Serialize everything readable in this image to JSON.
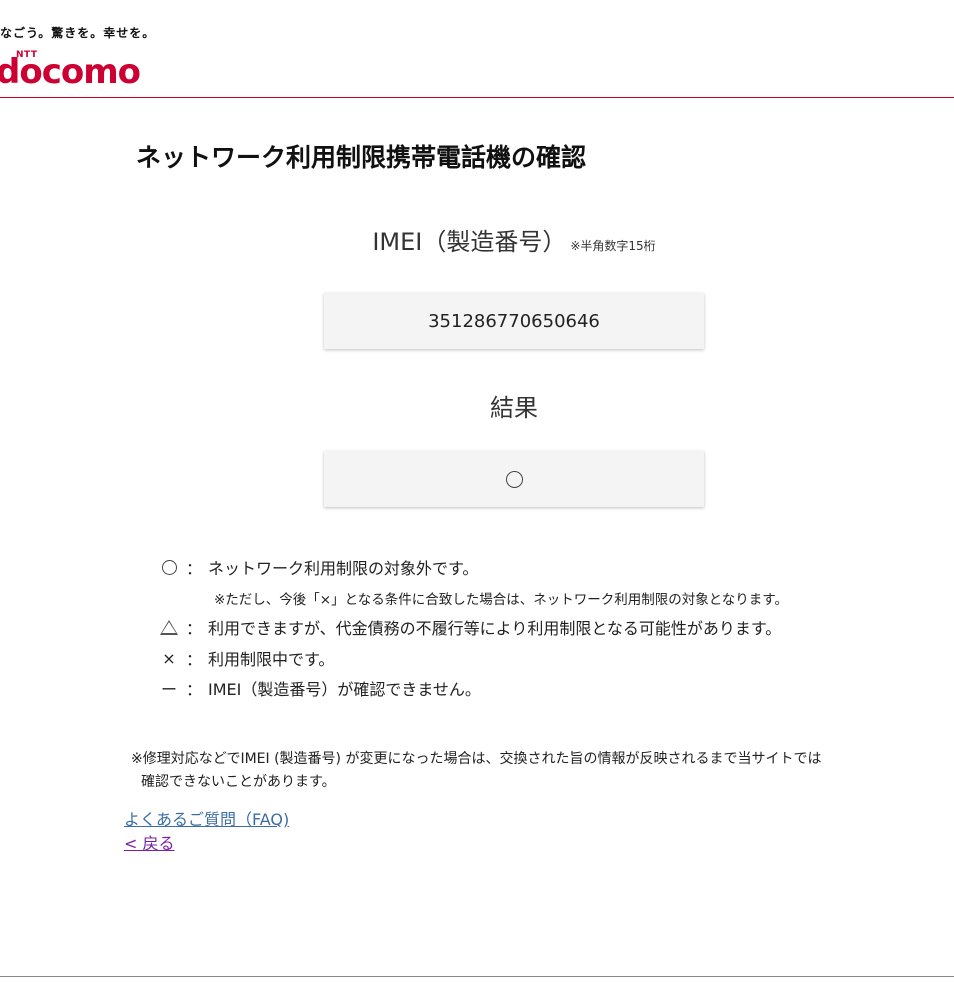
{
  "header": {
    "tagline": "なごう。驚きを。幸せを。",
    "logo_ntt": "NTT",
    "logo_text": "docomo"
  },
  "page_title": "ネットワーク利用制限携帯電話機の確認",
  "imei": {
    "label": "IMEI（製造番号）",
    "note": "※半角数字15桁",
    "value": "351286770650646"
  },
  "result": {
    "label": "結果",
    "value_icon": "circle-icon"
  },
  "legend": [
    {
      "symbol_icon": "circle-icon",
      "colon": "：",
      "text": "ネットワーク利用制限の対象外です。"
    },
    {
      "symbol_icon": "triangle-icon",
      "colon": "：",
      "text": "利用できますが、代金債務の不履行等により利用制限となる可能性があります。"
    },
    {
      "symbol": "×",
      "colon": "：",
      "text": "利用制限中です。"
    },
    {
      "symbol": "ー",
      "colon": "：",
      "text": "IMEI（製造番号）が確認できません。"
    }
  ],
  "legend_sub": "※ただし、今後「×」となる条件に合致した場合は、ネットワーク利用制限の対象となります。",
  "footnote": {
    "line1": "※修理対応などでIMEI (製造番号) が変更になった場合は、交換された旨の情報が反映されるまで当サイトでは",
    "line2": "確認できないことがあります。"
  },
  "links": {
    "faq": "よくあるご質問（FAQ)",
    "back": "< 戻る"
  },
  "colors": {
    "brand": "#cc0033",
    "link": "#3a6ea5",
    "visited_link": "#7a1fa2"
  }
}
